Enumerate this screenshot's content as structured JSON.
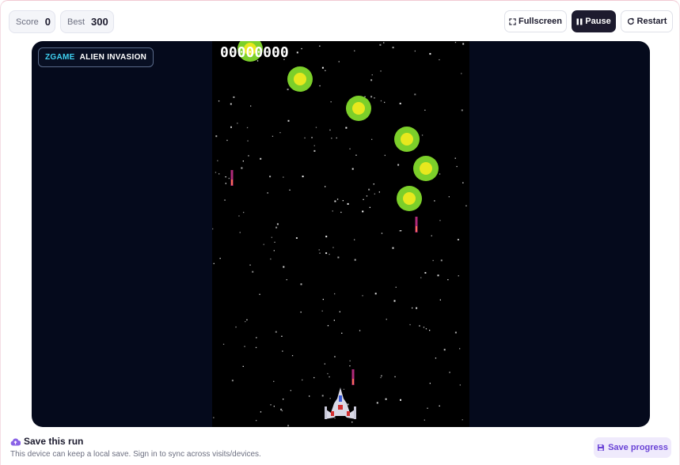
{
  "stats": {
    "score_label": "Score",
    "score_value": "0",
    "best_label": "Best",
    "best_value": "300"
  },
  "toolbar": {
    "fullscreen_label": "Fullscreen",
    "pause_label": "Pause",
    "restart_label": "Restart"
  },
  "game": {
    "brand": "ZGAME",
    "title": "ALIEN INVASION",
    "score_display": "00000000",
    "colors": {
      "outer_bg": "#050a1c",
      "field_bg": "#000000",
      "alien_outer": "#7ccf2a",
      "alien_inner": "#e8e81e",
      "bullet": "#b02a7a"
    }
  },
  "footer": {
    "save_title": "Save this run",
    "save_description": "This device can keep a local save. Sign in to sync across visits/devices.",
    "save_button_label": "Save progress",
    "accent": "#6a43d6"
  },
  "icons": {
    "fullscreen": "fullscreen-icon",
    "pause": "pause-icon",
    "restart": "restart-icon",
    "cloud_upload": "cloud-upload-icon",
    "save": "floppy-disk-icon"
  }
}
